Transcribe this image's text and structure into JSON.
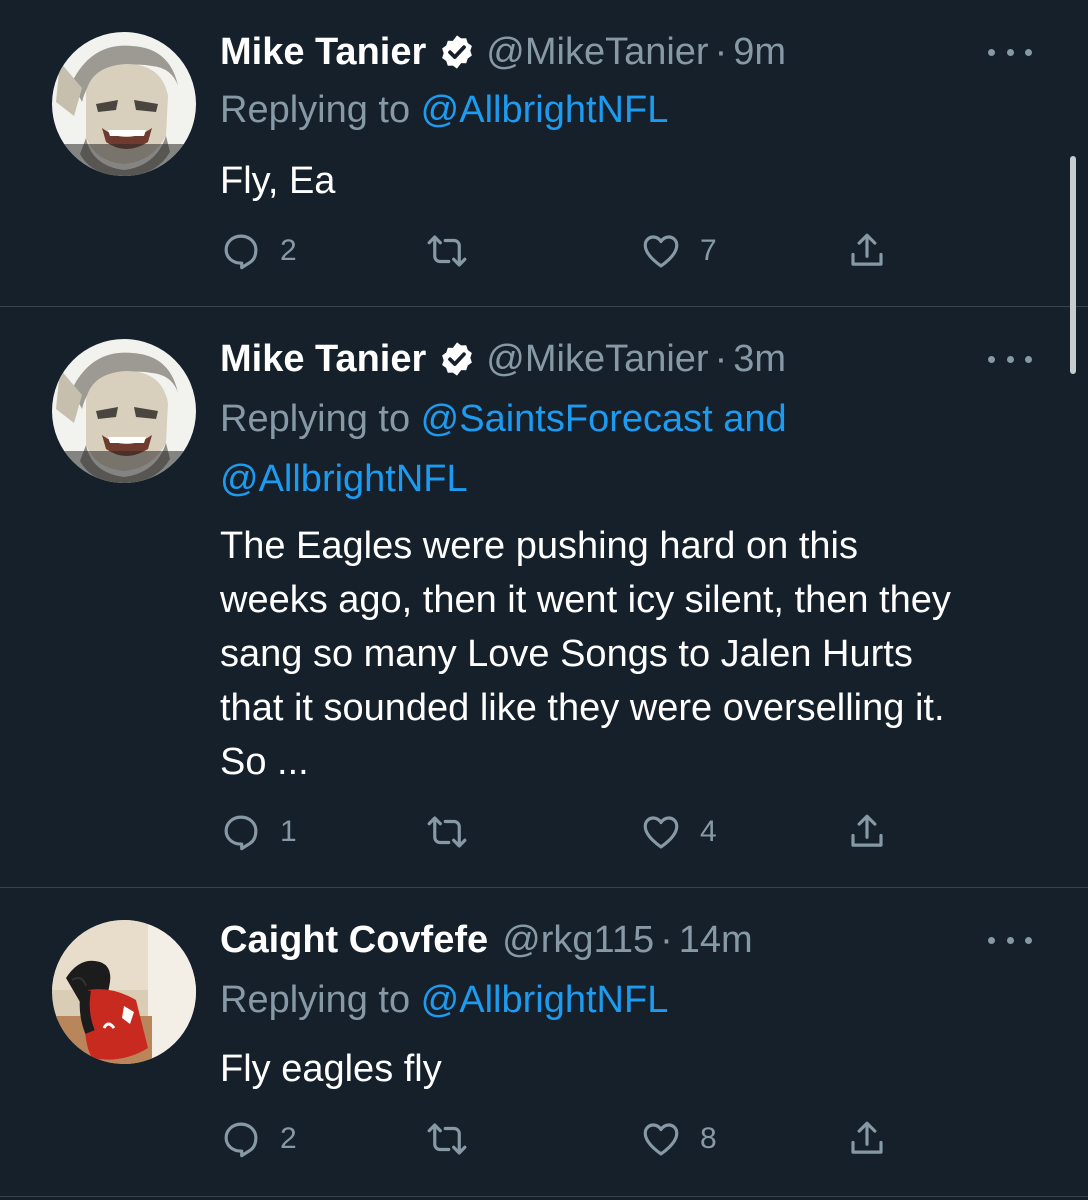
{
  "colors": {
    "background": "#15202b",
    "text_primary": "#ffffff",
    "text_secondary": "#8899a6",
    "link": "#1d9bf0",
    "verified_badge": "#ffffff",
    "divider": "#38444d"
  },
  "tweets": [
    {
      "name": "Mike Tanier",
      "verified": true,
      "handle": "@MikeTanier",
      "separator": "·",
      "time": "9m",
      "replying_prefix": "Replying to ",
      "replying_mentions": "@AllbrightNFL",
      "text": "Fly, Ea",
      "actions": {
        "reply_count": "2",
        "retweet_count": "",
        "like_count": "7",
        "share_icon": "share-icon"
      }
    },
    {
      "name": "Mike Tanier",
      "verified": true,
      "handle": "@MikeTanier",
      "separator": "·",
      "time": "3m",
      "replying_prefix": "Replying to ",
      "replying_mentions": "@SaintsForecast and @AllbrightNFL",
      "text": "The Eagles were pushing hard on this weeks ago, then it went icy silent, then they sang so many Love Songs to Jalen Hurts that it sounded like they were overselling it. So ...",
      "actions": {
        "reply_count": "1",
        "retweet_count": "",
        "like_count": "4",
        "share_icon": "share-icon"
      }
    },
    {
      "name": "Caight Covfefe",
      "verified": false,
      "handle": "@rkg115",
      "separator": "·",
      "time": "14m",
      "replying_prefix": "Replying to ",
      "replying_mentions": "@AllbrightNFL",
      "text": "Fly eagles fly",
      "actions": {
        "reply_count": "2",
        "retweet_count": "",
        "like_count": "8",
        "share_icon": "share-icon"
      }
    }
  ]
}
